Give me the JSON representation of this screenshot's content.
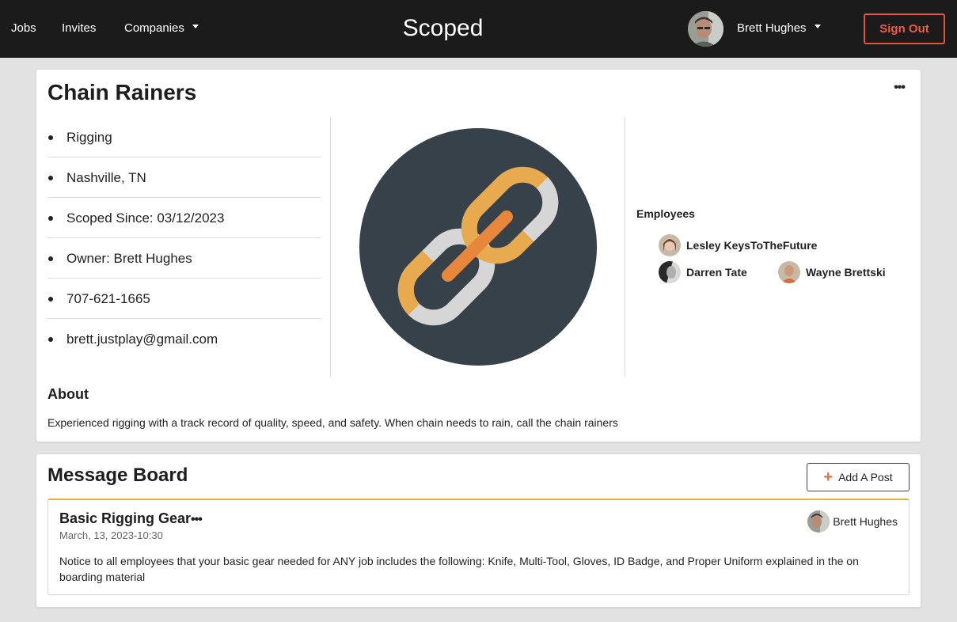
{
  "nav": {
    "jobs": "Jobs",
    "invites": "Invites",
    "companies": "Companies",
    "brand": "Scoped",
    "user_name": "Brett Hughes",
    "sign_out": "Sign Out"
  },
  "company": {
    "name": "Chain Rainers",
    "more_icon": "more-horizontal-icon",
    "details": [
      "Rigging",
      "Nashville, TN",
      "Scoped Since: 03/12/2023",
      "Owner: Brett Hughes",
      "707-621-1665",
      "brett.justplay@gmail.com"
    ],
    "logo_icon": "chain-link-icon",
    "employees_title": "Employees",
    "employees": [
      {
        "name": "Lesley KeysToTheFuture"
      },
      {
        "name": "Darren Tate"
      },
      {
        "name": "Wayne Brettski"
      }
    ],
    "about_title": "About",
    "about_text": "Experienced rigging with a track record of quality, speed, and safety. When chain needs to rain, call the chain rainers"
  },
  "board": {
    "title": "Message Board",
    "add_post": "Add A Post",
    "posts": [
      {
        "title": "Basic Rigging Gear",
        "more": "•••",
        "date": "March, 13, 2023-10:30",
        "author": "Brett Hughes",
        "body": "Notice to all employees that your basic gear needed for ANY job includes the following: Knife, Multi-Tool, Gloves, ID Badge, and Proper Uniform explained in the on boarding material"
      }
    ]
  },
  "colors": {
    "topbar": "#1b1b1b",
    "signout": "#ef5a45",
    "logo_bg": "#37414a",
    "chain_gold": "#e8aa4e",
    "chain_silver": "#d6d6d6",
    "chain_link": "#e7873c",
    "post_accent": "#eab03d"
  }
}
